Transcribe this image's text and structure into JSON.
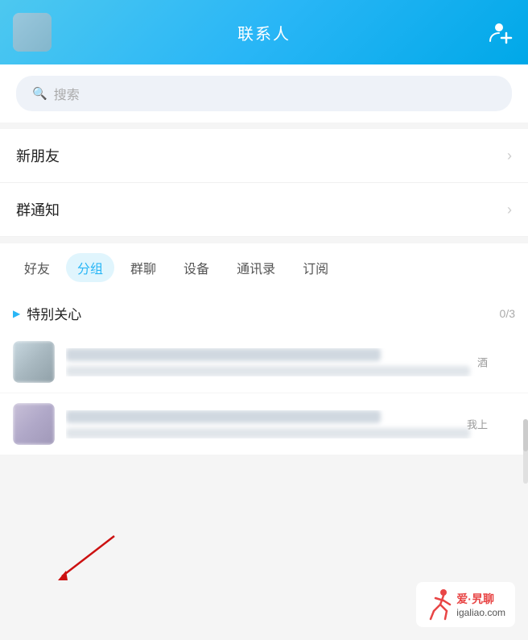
{
  "header": {
    "title": "联系人",
    "add_button_label": "添加联系人"
  },
  "search": {
    "placeholder": "搜索",
    "icon": "🔍"
  },
  "menu_items": [
    {
      "label": "新朋友",
      "id": "new-friends"
    },
    {
      "label": "群通知",
      "id": "group-notifications"
    }
  ],
  "tabs": [
    {
      "label": "好友",
      "active": false
    },
    {
      "label": "分组",
      "active": true
    },
    {
      "label": "群聊",
      "active": false
    },
    {
      "label": "设备",
      "active": false
    },
    {
      "label": "通讯录",
      "active": false
    },
    {
      "label": "订阅",
      "active": false
    }
  ],
  "group": {
    "title": "特别关心",
    "count": "0/3"
  },
  "contacts": [
    {
      "suffix": "酒"
    },
    {
      "suffix": "我上"
    }
  ],
  "watermark": {
    "line1": "爱·旯聊",
    "line2": "igaliao.com"
  }
}
